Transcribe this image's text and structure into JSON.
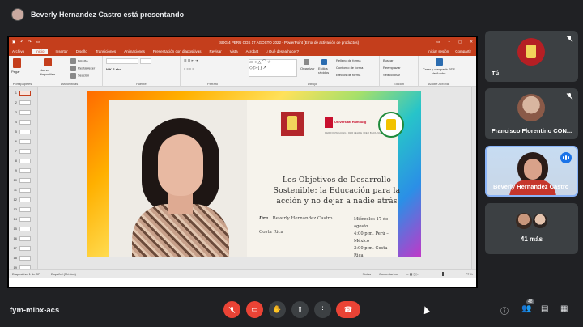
{
  "meet": {
    "presenting_banner": "Beverly Hernandez Castro está presentando",
    "meeting_code": "fym-mibx-acs",
    "participants_badge": "48",
    "colors": {
      "end_call": "#ea4335",
      "accent": "#1a73e8",
      "powerpoint": "#c43e1c"
    }
  },
  "participants": [
    {
      "name": "Tú"
    },
    {
      "name": "Francisco Florentino CON..."
    },
    {
      "name": "Beverly Hernandez Castro"
    },
    {
      "name": "41 más"
    }
  ],
  "powerpoint": {
    "window_title": "SDG 4 PERU ODS 17 AGOSTO 2022 - PowerPoint (Error de activación de productos)",
    "menu_tabs": [
      "Archivo",
      "Inicio",
      "Insertar",
      "Diseño",
      "Transiciones",
      "Animaciones",
      "Presentación con diapositivas",
      "Revisar",
      "Vista",
      "Acrobat",
      "¿Qué desea hacer?"
    ],
    "menu_right": [
      "Iniciar sesión",
      "Compartir"
    ],
    "ribbon": {
      "portapapeles": "Portapapeles",
      "pegar": "Pegar",
      "nueva_diapositiva": "Nueva diapositiva",
      "diseno": "Diseño",
      "restablecer": "Restablecer",
      "seccion": "Sección",
      "diapositivas": "Diapositivas",
      "fuente": "Fuente",
      "parrafo": "Párrafo",
      "dibujo": "Dibujo",
      "organizar": "Organizar",
      "estilos_rapidos": "Estilos rápidos",
      "relleno": "Relleno de forma",
      "contorno": "Contorno de forma",
      "efectos": "Efectos de forma",
      "buscar": "Buscar",
      "reemplazar": "Reemplazar",
      "seleccionar": "Seleccionar",
      "edicion": "Edición",
      "crear_pdf": "Crear y compartir PDF de Adobe",
      "adobe_acrobat": "Adobe Acrobat"
    },
    "thumbnails": [
      "1",
      "2",
      "3",
      "4",
      "5",
      "6",
      "7",
      "8",
      "9",
      "10",
      "11",
      "12",
      "13",
      "14",
      "15",
      "16",
      "17",
      "18",
      "19"
    ],
    "status": {
      "slide_counter": "Diapositiva 1 de 37",
      "language": "Español (México)",
      "notes": "Notas",
      "comments": "Comentarios",
      "zoom": "77 %"
    }
  },
  "slide": {
    "title": "Los Objetivos de Desarrollo Sostenible: la Educación para la acción y no dejar a nadie atrás",
    "author_prefix": "Dra.",
    "author_name": "Beverly Hernández Castro",
    "country": "Costa Rica",
    "schedule": [
      "Miércoles 17 de agosto.",
      "4:00 p.m. Perú – México",
      "3:00 p.m. Costa Rica"
    ],
    "logo_hamburg": "Universität Hamburg",
    "logo_hamburg_sub": "DER FORSCHUNG | DER LEHRE | DER BILDUNG"
  }
}
